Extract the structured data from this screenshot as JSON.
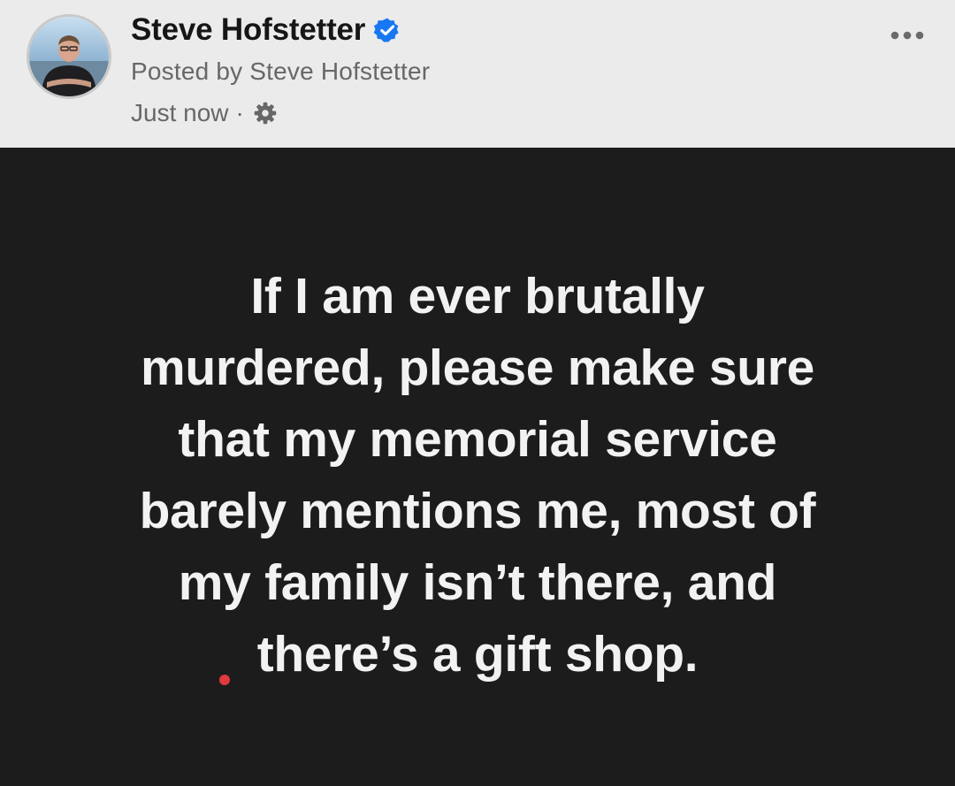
{
  "post": {
    "author_name": "Steve Hofstetter",
    "posted_by": "Posted by Steve Hofstetter",
    "timestamp": "Just now",
    "separator": "·",
    "verified_icon": "verified-badge-icon",
    "audience_icon": "gear-icon",
    "more_icon": "more-options-icon",
    "content_lines": [
      "If I am ever brutally",
      "murdered, please make sure",
      "that my memorial service",
      "barely mentions me, most of",
      "my family isn’t there, and",
      "there’s a gift shop."
    ]
  },
  "colors": {
    "header_background": "#ebebeb",
    "body_background": "#1c1c1c",
    "text_primary": "#f2f2f2",
    "verified_blue": "#1877f2",
    "meta_gray": "#676767",
    "red_dot": "#e0393e"
  }
}
